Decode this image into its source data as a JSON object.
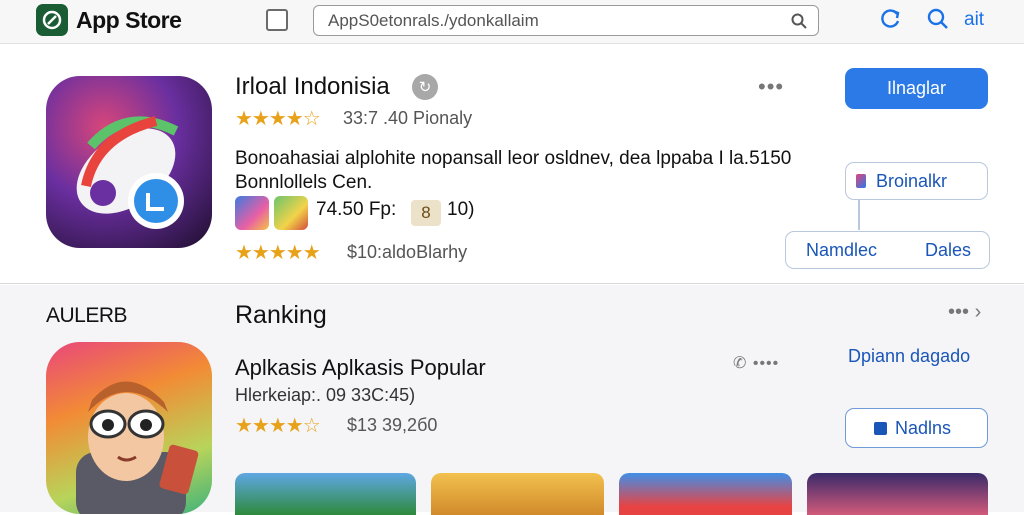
{
  "header": {
    "app_title": "App Store",
    "search_value": "AppS0etonrals./ydonkallaim",
    "right_label": "ait",
    "icons": [
      "app-store-logo-icon",
      "checkbox-icon",
      "search-icon",
      "refresh-icon",
      "search-icon"
    ]
  },
  "featured": {
    "title": "Irloal Indonisia",
    "badge": "↻",
    "rating_text": "33:7 .40 Pionaly",
    "description_line1": "Bonoahasiai alplohite nopansall leor osldnev, dea lppaba I la.5150",
    "description_line2": "Bonnlollels Cen.",
    "price_line": "74.50 Fp:",
    "chip": "8",
    "count": "10)",
    "rating2_text": "$10:aldoBlarhy",
    "primary_button": "Ilnaglar",
    "secondary_button": "Broinalkr",
    "seg_left": "Namdlec",
    "seg_right": "Dales"
  },
  "ranking": {
    "left_label": "AULERB",
    "title": "Ranking",
    "more": "••• ›",
    "subtitle": "Aplkasis Aplkasis Popular",
    "meta": "Hlerkeiap:. 09 33C:45)",
    "rating_text": "$13 39,2б0",
    "link": "Dpiann dagado",
    "button": "Nadlns"
  },
  "colors": {
    "accent": "#2b7ae8",
    "star": "#e7a21a",
    "link": "#1a56b8"
  }
}
